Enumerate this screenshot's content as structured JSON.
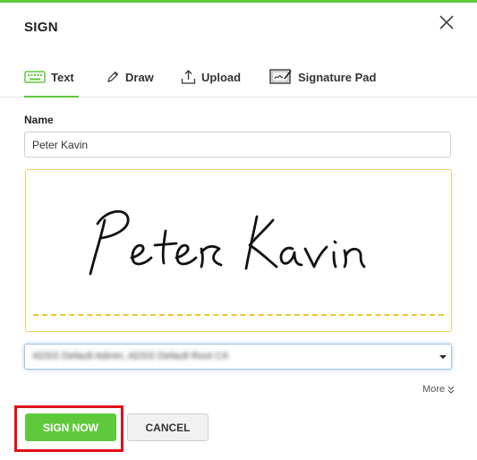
{
  "dialog": {
    "title": "SIGN"
  },
  "tabs": [
    {
      "label": "Text",
      "icon": "keyboard-icon",
      "active": true
    },
    {
      "label": "Draw",
      "icon": "pen-icon"
    },
    {
      "label": "Upload",
      "icon": "upload-icon"
    },
    {
      "label": "Signature Pad",
      "icon": "signature-pad-icon"
    }
  ],
  "form": {
    "name_label": "Name",
    "name_value": "Peter Kavin",
    "signature_text": "Peter Kavin",
    "certificate_value": "ADSS Default Admin, ADSS Default Root CA",
    "more_label": "More"
  },
  "buttons": {
    "sign_now": "SIGN NOW",
    "cancel": "CANCEL"
  },
  "colors": {
    "accent": "#5fc93c",
    "signature_border": "#f2d15a",
    "highlight": "#e0101a"
  }
}
